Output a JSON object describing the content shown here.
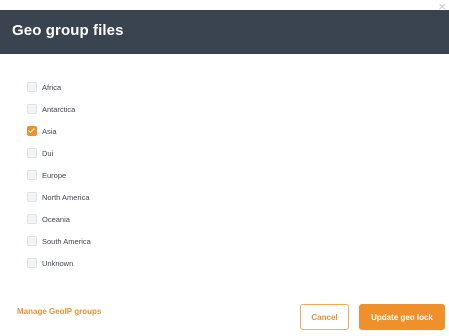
{
  "dialog": {
    "title": "Geo group files",
    "close_glyph": "×"
  },
  "groups": [
    {
      "label": "Africa",
      "checked": false
    },
    {
      "label": "Antarctica",
      "checked": false
    },
    {
      "label": "Asia",
      "checked": true
    },
    {
      "label": "Dui",
      "checked": false
    },
    {
      "label": "Europe",
      "checked": false
    },
    {
      "label": "North America",
      "checked": false
    },
    {
      "label": "Oceania",
      "checked": false
    },
    {
      "label": "South America",
      "checked": false
    },
    {
      "label": "Unknown",
      "checked": false
    }
  ],
  "footer": {
    "manage_link": "Manage GeoIP groups",
    "cancel_label": "Cancel",
    "update_label": "Update geo lock"
  },
  "colors": {
    "header_bg": "#3a4451",
    "accent": "#f0902a"
  }
}
